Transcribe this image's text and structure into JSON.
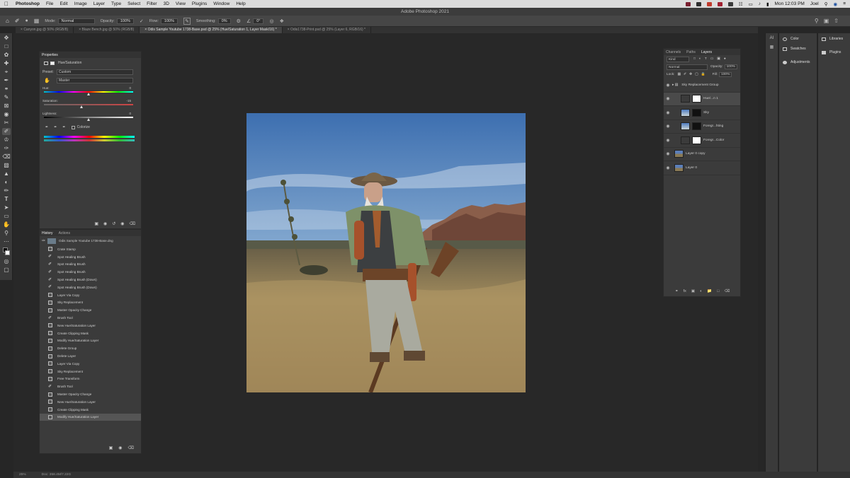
{
  "menubar": {
    "apple": "",
    "app": "Photoshop",
    "items": [
      "File",
      "Edit",
      "Image",
      "Layer",
      "Type",
      "Select",
      "Filter",
      "3D",
      "View",
      "Plugins",
      "Window",
      "Help"
    ],
    "clock": "Mon 12:03 PM",
    "user": "Joel"
  },
  "window_title": "Adobe Photoshop 2021",
  "options": {
    "mode_label": "Mode:",
    "mode_value": "Normal",
    "opacity_label": "Opacity:",
    "opacity_value": "100%",
    "flow_label": "Flow:",
    "flow_value": "100%",
    "smoothing_label": "Smoothing:",
    "smoothing_value": "0%",
    "angle_value": "0°"
  },
  "tabs": [
    "Canyon.jpg @ 50% (RGB/8)",
    "Blaze Bench.jpg @ 50% (RGB/8)",
    "Odis Sample Youtube 1738-Base.psd @ 25% (Hue/Saturation 1, Layer Mask/16) *",
    "Odis1738-Print.psd @ 25% (Layer 6, RGB/16) *"
  ],
  "properties": {
    "tab": "Properties",
    "adjustment_title": "Hue/Saturation",
    "preset_label": "Preset:",
    "preset_value": "Custom",
    "channel_value": "Master",
    "hue_label": "Hue:",
    "hue_value": "0",
    "saturation_label": "Saturation:",
    "saturation_value": "-15",
    "lightness_label": "Lightness:",
    "lightness_value": "0",
    "colorize_label": "Colorize"
  },
  "history": {
    "tabs": [
      "History",
      "Actions"
    ],
    "snapshot": "Odis Sample Youtube 1738-Base.dng",
    "items": [
      {
        "label": "Crate Stamp",
        "icon": "stamp-icon"
      },
      {
        "label": "Spot Healing Brush",
        "icon": "brush-icon"
      },
      {
        "label": "Spot Healing Brush",
        "icon": "brush-icon"
      },
      {
        "label": "Spot Healing Brush",
        "icon": "brush-icon"
      },
      {
        "label": "Spot Healing Brush (Down)",
        "icon": "brush-icon"
      },
      {
        "label": "Spot Healing Brush (Down)",
        "icon": "brush-icon"
      },
      {
        "label": "Layer Via Copy",
        "icon": "layer-icon"
      },
      {
        "label": "Sky Replacement",
        "icon": "layer-icon"
      },
      {
        "label": "Master Opacity Change",
        "icon": "layer-icon"
      },
      {
        "label": "Brush Tool",
        "icon": "brush-icon"
      },
      {
        "label": "New Hue/Saturation Layer",
        "icon": "layer-icon"
      },
      {
        "label": "Create Clipping Mask",
        "icon": "layer-icon"
      },
      {
        "label": "Modify Hue/Saturation Layer",
        "icon": "layer-icon"
      },
      {
        "label": "Delete Group",
        "icon": "layer-icon"
      },
      {
        "label": "Delete Layer",
        "icon": "layer-icon"
      },
      {
        "label": "Layer Via Copy",
        "icon": "layer-icon"
      },
      {
        "label": "Sky Replacement",
        "icon": "layer-icon"
      },
      {
        "label": "Free Transform",
        "icon": "layer-icon"
      },
      {
        "label": "Brush Tool",
        "icon": "brush-icon"
      },
      {
        "label": "Master Opacity Change",
        "icon": "layer-icon"
      },
      {
        "label": "New Hue/Saturation Layer",
        "icon": "layer-icon"
      },
      {
        "label": "Create Clipping Mask",
        "icon": "layer-icon"
      },
      {
        "label": "Modify Hue/Saturation Layer",
        "icon": "layer-icon"
      }
    ]
  },
  "layers_panel": {
    "tabs": [
      "Channels",
      "Paths",
      "Layers"
    ],
    "kind_label": "Kind",
    "blend_mode": "Normal",
    "opacity_label": "Opacity:",
    "opacity_value": "100%",
    "lock_label": "Lock:",
    "fill_label": "Fill:",
    "fill_value": "100%",
    "layers": [
      {
        "name": "Sky Replacement Group",
        "type": "group"
      },
      {
        "name": "Hue/...n 1",
        "type": "adjustment"
      },
      {
        "name": "Sky",
        "type": "sky"
      },
      {
        "name": "Foregr...hting",
        "type": "sky"
      },
      {
        "name": "Foregr...Color",
        "type": "adjustment"
      },
      {
        "name": "Layer 0 copy",
        "type": "photo"
      },
      {
        "name": "Layer 0",
        "type": "photo"
      }
    ]
  },
  "right_panels": {
    "col1": [
      "Color",
      "Swatches",
      "Adjustments"
    ],
    "col2": [
      "Libraries",
      "Plugins"
    ]
  },
  "status": {
    "zoom": "25%",
    "doc_size": "Doc: 358.4M/7.22G"
  }
}
